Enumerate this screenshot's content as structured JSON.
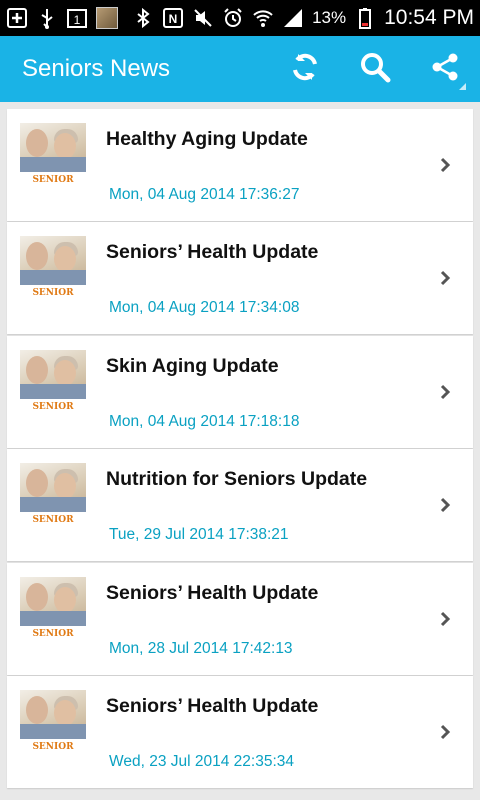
{
  "status_bar": {
    "battery_percent": "13%",
    "time": "10:54 PM",
    "icons": [
      "add-icon",
      "usb-icon",
      "calendar-1-icon",
      "photo-thumbnail",
      "bluetooth-icon",
      "nfc-icon",
      "mute-icon",
      "alarm-icon",
      "wifi-icon",
      "signal-icon",
      "battery-icon"
    ],
    "calendar_day": "1"
  },
  "action_bar": {
    "title": "Seniors News",
    "icons": [
      "refresh-icon",
      "search-icon",
      "share-icon"
    ],
    "color": "#1ab3e6"
  },
  "thumbnail_label": "SENIOR CARE",
  "items": [
    {
      "title": "Healthy Aging Update",
      "date": "Mon, 04 Aug 2014 17:36:27"
    },
    {
      "title": "Seniors’ Health Update",
      "date": "Mon, 04 Aug 2014 17:34:08"
    },
    {
      "title": "Skin Aging Update",
      "date": "Mon, 04 Aug 2014 17:18:18"
    },
    {
      "title": "Nutrition for Seniors Update",
      "date": "Tue, 29 Jul 2014 17:38:21"
    },
    {
      "title": "Seniors’ Health Update",
      "date": "Mon, 28 Jul 2014 17:42:13"
    },
    {
      "title": "Seniors’ Health Update",
      "date": "Wed, 23 Jul 2014 22:35:34"
    }
  ],
  "date_color": "#0aa1c2"
}
